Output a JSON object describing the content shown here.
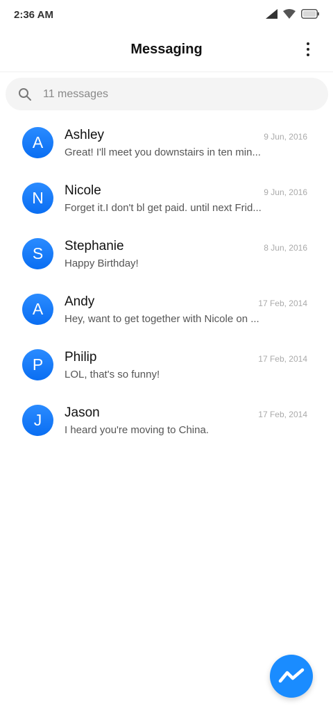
{
  "status_bar": {
    "time": "2:36 AM"
  },
  "header": {
    "title": "Messaging"
  },
  "search": {
    "placeholder": "11 messages"
  },
  "conversations": [
    {
      "initial": "A",
      "name": "Ashley",
      "date": "9 Jun, 2016",
      "preview": "Great! I'll meet you downstairs in ten min..."
    },
    {
      "initial": "N",
      "name": "Nicole",
      "date": "9 Jun, 2016",
      "preview": "Forget it.I don't bl get paid. until next Frid..."
    },
    {
      "initial": "S",
      "name": "Stephanie",
      "date": "8 Jun, 2016",
      "preview": "Happy Birthday!"
    },
    {
      "initial": "A",
      "name": "Andy",
      "date": "17 Feb, 2014",
      "preview": "Hey, want to get together with Nicole on ..."
    },
    {
      "initial": "P",
      "name": "Philip",
      "date": "17 Feb, 2014",
      "preview": "LOL, that's so funny!"
    },
    {
      "initial": "J",
      "name": "Jason",
      "date": "17 Feb, 2014",
      "preview": "I heard you're moving to China."
    }
  ],
  "colors": {
    "accent": "#1a8cff",
    "avatar": "#0a6ef2"
  },
  "icons": {
    "status": [
      "signal-icon",
      "wifi-icon",
      "battery-icon"
    ],
    "menu": "more-vert-icon",
    "search": "search-icon",
    "fab": "new-message-icon"
  }
}
